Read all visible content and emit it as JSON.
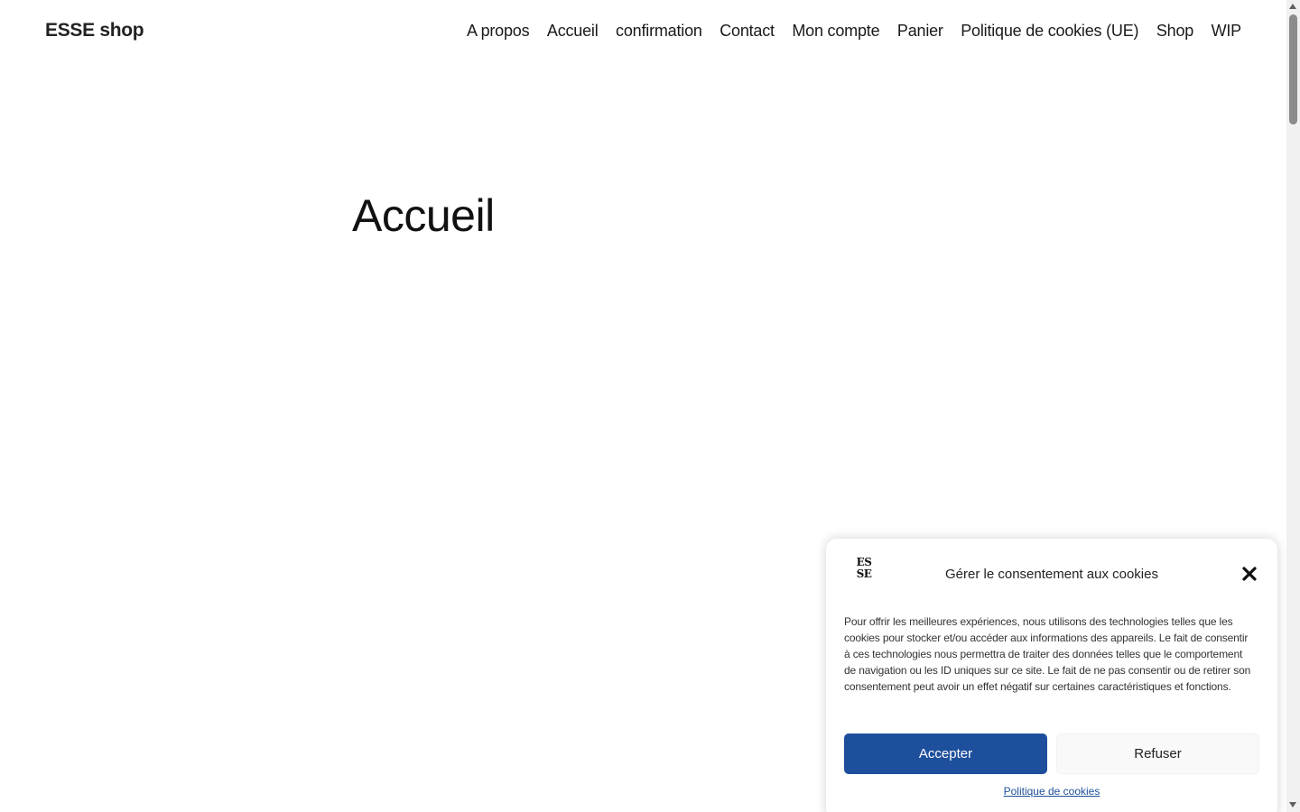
{
  "header": {
    "site_title": "ESSE shop",
    "nav": [
      {
        "label": "A propos"
      },
      {
        "label": "Accueil"
      },
      {
        "label": "confirmation"
      },
      {
        "label": "Contact"
      },
      {
        "label": "Mon compte"
      },
      {
        "label": "Panier"
      },
      {
        "label": "Politique de cookies (UE)"
      },
      {
        "label": "Shop"
      },
      {
        "label": "WIP"
      }
    ]
  },
  "main": {
    "title": "Accueil"
  },
  "cookie_banner": {
    "logo_lines": [
      "ES",
      "SE"
    ],
    "title": "Gérer le consentement aux cookies",
    "body": "Pour offrir les meilleures expériences, nous utilisons des technologies telles que les cookies pour stocker et/ou accéder aux informations des appareils. Le fait de consentir à ces technologies nous permettra de traiter des données telles que le comportement de navigation ou les ID uniques sur ce site. Le fait de ne pas consentir ou de retirer son consentement peut avoir un effet négatif sur certaines caractéristiques et fonctions.",
    "accept_label": "Accepter",
    "refuse_label": "Refuser",
    "policy_link": "Politique de cookies",
    "close_icon": "close-icon"
  },
  "colors": {
    "accent": "#1e4f9c",
    "text": "#111111",
    "background": "#ffffff"
  }
}
